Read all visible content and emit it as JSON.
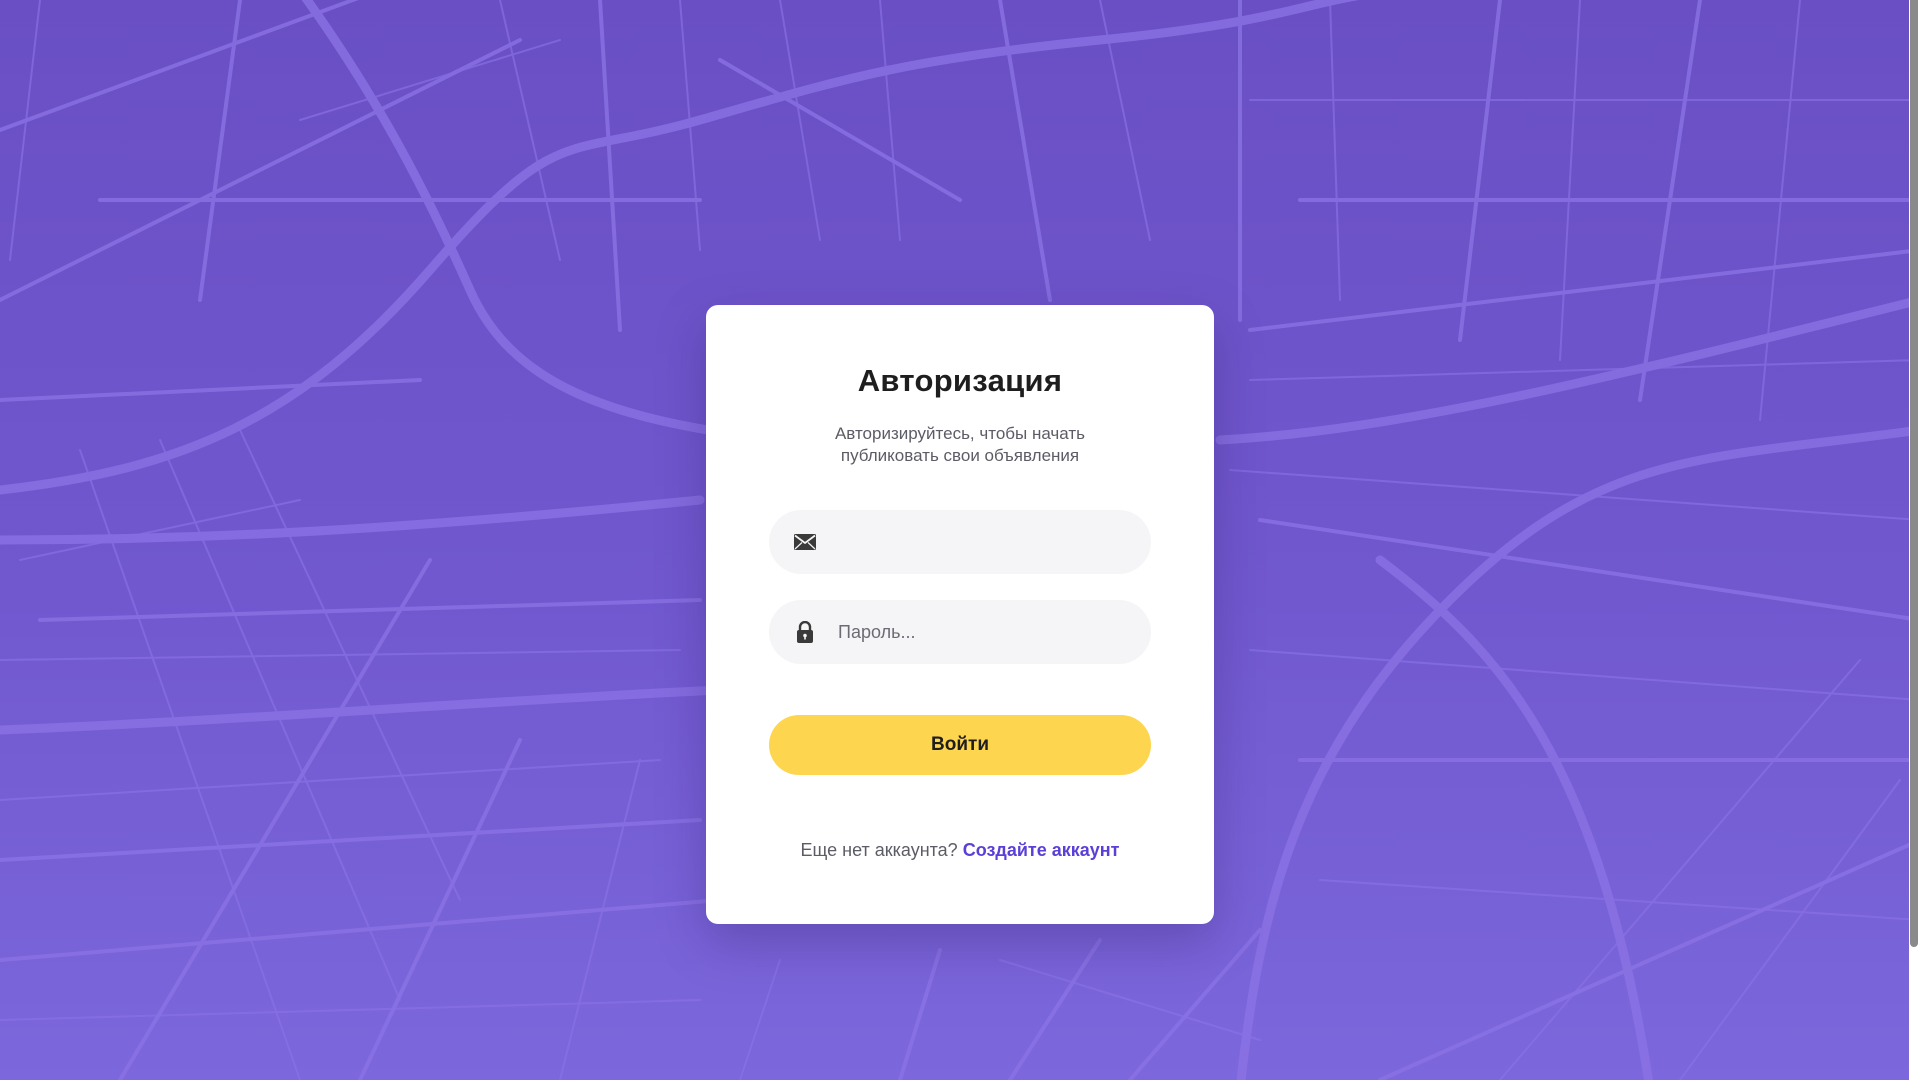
{
  "background": {
    "description_icon": "city-map-pattern",
    "colors": {
      "top": "#6a4fc4",
      "bottom": "#7c67dc",
      "streets": "#8c74e6"
    }
  },
  "auth": {
    "title": "Авторизация",
    "subtitle": "Авторизируйтесь, чтобы начать публиковать свои объявления",
    "email": {
      "icon": "envelope-icon",
      "value": "",
      "placeholder": ""
    },
    "password": {
      "icon": "lock-icon",
      "value": "",
      "placeholder": "Пароль..."
    },
    "submit_label": "Войти",
    "submit_color": "#fdd54f",
    "signup_prompt": "Еще нет аккаунта?",
    "signup_link": "Создайте аккаунт",
    "link_color": "#5b3fd6"
  }
}
